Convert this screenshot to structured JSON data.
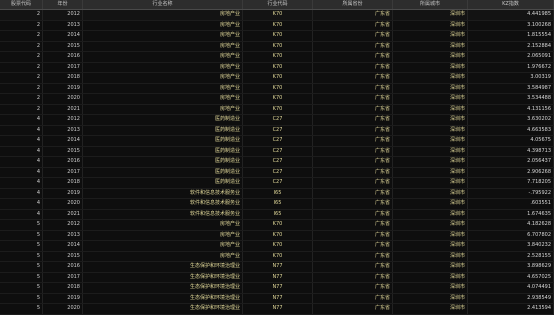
{
  "columns": [
    "股票代码",
    "年份",
    "行业名称",
    "行业代码",
    "所属省份",
    "所属城市",
    "KZ指数"
  ],
  "rows": [
    [
      "2",
      "2012",
      "房地产业",
      "K70",
      "广东省",
      "深圳市",
      "4.441985"
    ],
    [
      "2",
      "2013",
      "房地产业",
      "K70",
      "广东省",
      "深圳市",
      "3.100268"
    ],
    [
      "2",
      "2014",
      "房地产业",
      "K70",
      "广东省",
      "深圳市",
      "1.815554"
    ],
    [
      "2",
      "2015",
      "房地产业",
      "K70",
      "广东省",
      "深圳市",
      "2.152884"
    ],
    [
      "2",
      "2016",
      "房地产业",
      "K70",
      "广东省",
      "深圳市",
      "2.065091"
    ],
    [
      "2",
      "2017",
      "房地产业",
      "K70",
      "广东省",
      "深圳市",
      "1.976672"
    ],
    [
      "2",
      "2018",
      "房地产业",
      "K70",
      "广东省",
      "深圳市",
      "3.00319"
    ],
    [
      "2",
      "2019",
      "房地产业",
      "K70",
      "广东省",
      "深圳市",
      "3.584987"
    ],
    [
      "2",
      "2020",
      "房地产业",
      "K70",
      "广东省",
      "深圳市",
      "3.534488"
    ],
    [
      "2",
      "2021",
      "房地产业",
      "K70",
      "广东省",
      "深圳市",
      "4.131156"
    ],
    [
      "4",
      "2012",
      "医药制造业",
      "C27",
      "广东省",
      "深圳市",
      "3.630202"
    ],
    [
      "4",
      "2013",
      "医药制造业",
      "C27",
      "广东省",
      "深圳市",
      "4.663583"
    ],
    [
      "4",
      "2014",
      "医药制造业",
      "C27",
      "广东省",
      "深圳市",
      "4.05675"
    ],
    [
      "4",
      "2015",
      "医药制造业",
      "C27",
      "广东省",
      "深圳市",
      "4.398713"
    ],
    [
      "4",
      "2016",
      "医药制造业",
      "C27",
      "广东省",
      "深圳市",
      "2.056437"
    ],
    [
      "4",
      "2017",
      "医药制造业",
      "C27",
      "广东省",
      "深圳市",
      "2.906268"
    ],
    [
      "4",
      "2018",
      "医药制造业",
      "C27",
      "广东省",
      "深圳市",
      "7.718205"
    ],
    [
      "4",
      "2019",
      "软件和信息技术服务业",
      "I65",
      "广东省",
      "深圳市",
      "-.795922"
    ],
    [
      "4",
      "2020",
      "软件和信息技术服务业",
      "I65",
      "广东省",
      "深圳市",
      ".603551"
    ],
    [
      "4",
      "2021",
      "软件和信息技术服务业",
      "I65",
      "广东省",
      "深圳市",
      "1.674635"
    ],
    [
      "5",
      "2012",
      "房地产业",
      "K70",
      "广东省",
      "深圳市",
      "4.182628"
    ],
    [
      "5",
      "2013",
      "房地产业",
      "K70",
      "广东省",
      "深圳市",
      "6.707802"
    ],
    [
      "5",
      "2014",
      "房地产业",
      "K70",
      "广东省",
      "深圳市",
      "3.840232"
    ],
    [
      "5",
      "2015",
      "房地产业",
      "K70",
      "广东省",
      "深圳市",
      "2.528155"
    ],
    [
      "5",
      "2016",
      "生态保护和环境治理业",
      "N77",
      "广东省",
      "深圳市",
      "3.898629"
    ],
    [
      "5",
      "2017",
      "生态保护和环境治理业",
      "N77",
      "广东省",
      "深圳市",
      "4.657025"
    ],
    [
      "5",
      "2018",
      "生态保护和环境治理业",
      "N77",
      "广东省",
      "深圳市",
      "4.074491"
    ],
    [
      "5",
      "2019",
      "生态保护和环境治理业",
      "N77",
      "广东省",
      "深圳市",
      "2.938549"
    ],
    [
      "5",
      "2020",
      "生态保护和环境治理业",
      "N77",
      "广东省",
      "深圳市",
      "2.413594"
    ]
  ],
  "colors": {
    "background": "#0e0e0e",
    "header_background": "#2d2d2d",
    "string_text": "#e2d99a",
    "numeric_text": "#d8d8d8"
  }
}
